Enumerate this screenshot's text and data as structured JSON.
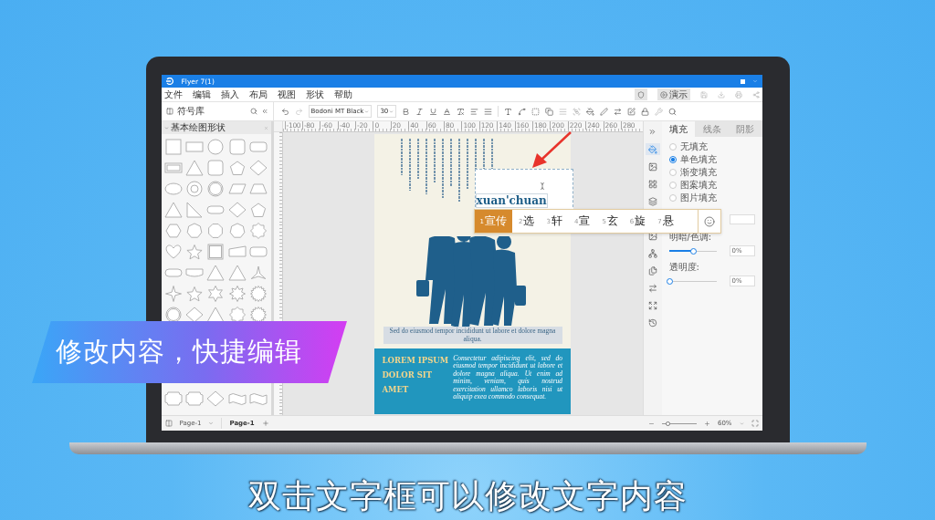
{
  "window": {
    "title": "Flyer 7(1)"
  },
  "menu": [
    "文件",
    "编辑",
    "插入",
    "布局",
    "视图",
    "形状",
    "帮助"
  ],
  "present_button": "演示",
  "symbol_panel": {
    "title": "符号库",
    "section": "基本绘图形状"
  },
  "toolbar": {
    "font": "Bodoni MT Black",
    "size": "30"
  },
  "ruler_marks": [
    "-100",
    "-80",
    "-60",
    "-40",
    "-20",
    "0",
    "20",
    "40",
    "60",
    "80",
    "100",
    "120",
    "140",
    "160",
    "180",
    "200",
    "220",
    "240",
    "260",
    "280"
  ],
  "poster": {
    "text_box": "xuan'chuan",
    "caption": "Sed do eiusmod tempor incididunt ut labore et dolore magna aliqua.",
    "headline": [
      "LOREM IPSUM",
      "DOLOR SIT",
      "AMET"
    ],
    "body": "Consectetur adipiscing elit, sed do eiusmod tempor incididunt ut labore et dolore magna aliqua. Ut enim ad minim, veniam, quis nostrud exercitation ullamco laboris nisi ut aliquip exea commodo consequat."
  },
  "ime": {
    "candidates": [
      {
        "index": "1",
        "text": "宣传",
        "selected": true
      },
      {
        "index": "2",
        "text": "选",
        "selected": false
      },
      {
        "index": "3",
        "text": "轩",
        "selected": false
      },
      {
        "index": "4",
        "text": "宣",
        "selected": false
      },
      {
        "index": "5",
        "text": "玄",
        "selected": false
      },
      {
        "index": "6",
        "text": "旋",
        "selected": false
      },
      {
        "index": "7",
        "text": "悬",
        "selected": false
      }
    ]
  },
  "right_panel": {
    "tabs": [
      {
        "label": "填充",
        "selected": true
      },
      {
        "label": "线条",
        "selected": false
      },
      {
        "label": "阴影",
        "selected": false
      }
    ],
    "fill_options": [
      {
        "label": "无填充",
        "selected": false
      },
      {
        "label": "单色填充",
        "selected": true
      },
      {
        "label": "渐变填充",
        "selected": false
      },
      {
        "label": "图案填充",
        "selected": false
      },
      {
        "label": "图片填充",
        "selected": false
      }
    ],
    "sliders": [
      {
        "label": "明暗/色调:",
        "level": 0.5,
        "value": "0%"
      },
      {
        "label": "透明度:",
        "level": 0,
        "value": "0%"
      }
    ]
  },
  "status_bar": {
    "page_select": "Page-1",
    "page_tab": "Page-1",
    "zoom_slider": {
      "level": 0.1
    },
    "zoom": "60%"
  },
  "banner": "修改内容，快捷编辑",
  "subtitle": "双击文字框可以修改文字内容"
}
